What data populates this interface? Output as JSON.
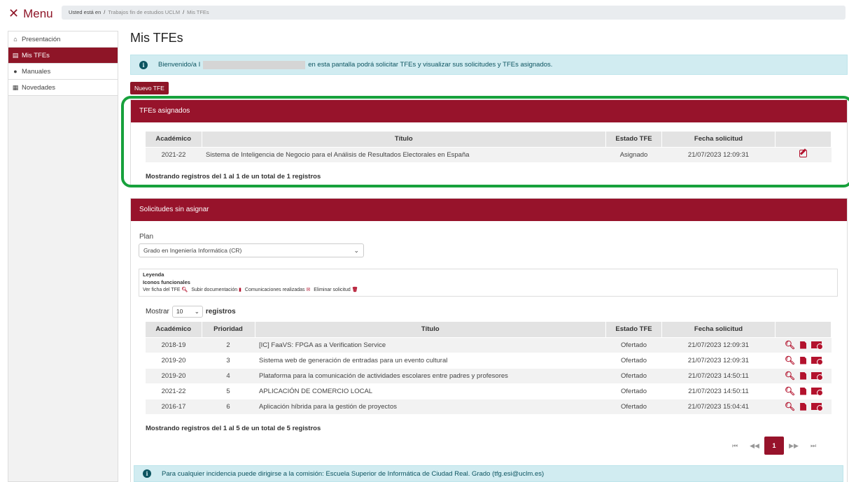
{
  "topbar": {
    "menu_label": "Menu",
    "breadcrumb_prefix": "Usted está en",
    "crumbs": [
      "Trabajos fin de estudios UCLM",
      "Mis TFEs"
    ]
  },
  "sidebar": {
    "items": [
      {
        "label": "Presentación",
        "icon": "home-icon"
      },
      {
        "label": "Mis TFEs",
        "icon": "document-icon"
      },
      {
        "label": "Manuales",
        "icon": "info-icon"
      },
      {
        "label": "Novedades",
        "icon": "newspaper-icon"
      }
    ]
  },
  "main": {
    "title": "Mis TFEs",
    "welcome_prefix": "Bienvenido/a I",
    "welcome_suffix": "en esta pantalla podrá solicitar TFEs y visualizar sus solicitudes y TFEs asignados.",
    "new_button": "Nuevo TFE"
  },
  "assigned": {
    "title": "TFEs asignados",
    "headers": [
      "Académico",
      "Título",
      "Estado TFE",
      "Fecha solicitud",
      ""
    ],
    "rows": [
      {
        "academico": "2021-22",
        "titulo": "Sistema de Inteligencia de Negocio para el Análisis de Resultados Electorales en España",
        "estado": "Asignado",
        "fecha": "21/07/2023 12:09:31"
      }
    ],
    "footer": "Mostrando registros del 1 al 1 de un total de 1 registros"
  },
  "unassigned": {
    "title": "Solicitudes sin asignar",
    "plan_label": "Plan",
    "plan_value": "Grado en Ingeniería Informática (CR)",
    "legend_title": "Leyenda",
    "legend_subtitle": "Iconos funcionales",
    "legend_items": [
      "Ver ficha del TFE",
      "Subir documentación",
      "Comunicaciones realizadas",
      "Eliminar solicitud"
    ],
    "show_label": "Mostrar",
    "show_value": "10",
    "show_suffix": "registros",
    "headers": [
      "Académico",
      "Prioridad",
      "Título",
      "Estado TFE",
      "Fecha solicitud",
      ""
    ],
    "rows": [
      {
        "academico": "2018-19",
        "prioridad": "2",
        "titulo": "[IC] FaaVS: FPGA as a Verification Service",
        "estado": "Ofertado",
        "fecha": "21/07/2023 12:09:31"
      },
      {
        "academico": "2019-20",
        "prioridad": "3",
        "titulo": "Sistema web de generación de entradas para un evento cultural",
        "estado": "Ofertado",
        "fecha": "21/07/2023 12:09:31"
      },
      {
        "academico": "2019-20",
        "prioridad": "4",
        "titulo": "Plataforma para la comunicación de actividades escolares entre padres y profesores",
        "estado": "Ofertado",
        "fecha": "21/07/2023 14:50:11"
      },
      {
        "academico": "2021-22",
        "prioridad": "5",
        "titulo": "APLICACIÓN DE COMERCIO LOCAL",
        "estado": "Ofertado",
        "fecha": "21/07/2023 14:50:11"
      },
      {
        "academico": "2016-17",
        "prioridad": "6",
        "titulo": "Aplicación híbrida para la gestión de proyectos",
        "estado": "Ofertado",
        "fecha": "21/07/2023 15:04:41"
      }
    ],
    "footer": "Mostrando registros del 1 al 5 de un total de 5 registros",
    "pagination": {
      "first": "⏮",
      "prev": "◀◀",
      "current": "1",
      "next": "▶▶",
      "last": "⏭"
    }
  },
  "bottom_info": "Para cualquier incidencia puede dirigirse a la comisión: Escuela Superior de Informática de Ciudad Real. Grado (tfg.esi@uclm.es)",
  "colors": {
    "brand": "#97132b",
    "highlight": "#17a13c",
    "info_bg": "#d1ecf1"
  }
}
